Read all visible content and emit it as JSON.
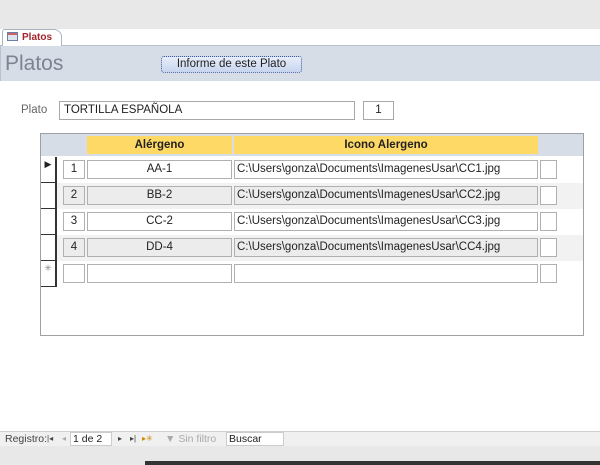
{
  "tab": {
    "label": "Platos",
    "icon": "form-icon"
  },
  "header": {
    "title": "Platos",
    "report_button": "Informe de este Plato"
  },
  "form": {
    "plato_label": "Plato",
    "plato_value": "TORTILLA ESPAÑOLA",
    "id_value": "1"
  },
  "subform": {
    "columns": [
      "Alérgeno",
      "Icono Alergeno"
    ],
    "rows": [
      {
        "n": "1",
        "alergeno": "AA-1",
        "icono": "C:\\Users\\gonza\\Documents\\ImagenesUsar\\CC1.jpg"
      },
      {
        "n": "2",
        "alergeno": "BB-2",
        "icono": "C:\\Users\\gonza\\Documents\\ImagenesUsar\\CC2.jpg"
      },
      {
        "n": "3",
        "alergeno": "CC-2",
        "icono": "C:\\Users\\gonza\\Documents\\ImagenesUsar\\CC3.jpg"
      },
      {
        "n": "4",
        "alergeno": "DD-4",
        "icono": "C:\\Users\\gonza\\Documents\\ImagenesUsar\\CC4.jpg"
      }
    ],
    "current_marker": "▶",
    "new_marker": "✳"
  },
  "navbar": {
    "label": "Registro:",
    "first": "|◂",
    "prev": "◂",
    "position": "1 de 2",
    "next": "▸",
    "last": "▸|",
    "new": "▸✳",
    "filter": "Sin filtro",
    "search": "Buscar"
  }
}
